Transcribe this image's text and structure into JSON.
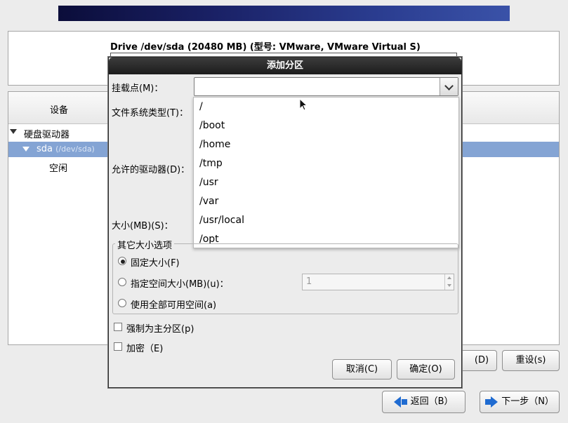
{
  "installer": {
    "drive_label": "Drive /dev/sda (20480 MB) (型号: VMware, VMware Virtual S)",
    "column_device": "设备",
    "tree": {
      "hard_drives": "硬盘驱动器",
      "sda": "sda",
      "sda_path": "(/dev/sda)",
      "free": "空闲"
    },
    "buttons": {
      "delete_partial": "(D)",
      "reset": "重设(s)",
      "back": "返回（B）",
      "next": "下一步（N）"
    }
  },
  "dialog": {
    "title": "添加分区",
    "mount_point_label": "挂载点(M)：",
    "mount_point_value": "",
    "fs_type_label": "文件系统类型(T)：",
    "allowed_drives_label": "允许的驱动器(D)：",
    "size_label": "大小(MB)(S)：",
    "mount_options": [
      "/",
      "/boot",
      "/home",
      "/tmp",
      "/usr",
      "/var",
      "/usr/local",
      "/opt"
    ],
    "size_options_title": "其它大小选项",
    "size_options": {
      "fixed": "固定大小(F)",
      "up_to": "指定空间大小(MB)(u)：",
      "fill_all": "使用全部可用空间(a)"
    },
    "up_to_value": "1",
    "force_primary": "强制为主分区(p)",
    "encrypt": "加密（E)",
    "cancel": "取消(C)",
    "ok": "确定(O)"
  },
  "colors": {
    "selection": "#84a4d4",
    "title_bar": "#2a2a2a",
    "arrow": "#1f6bd1"
  }
}
